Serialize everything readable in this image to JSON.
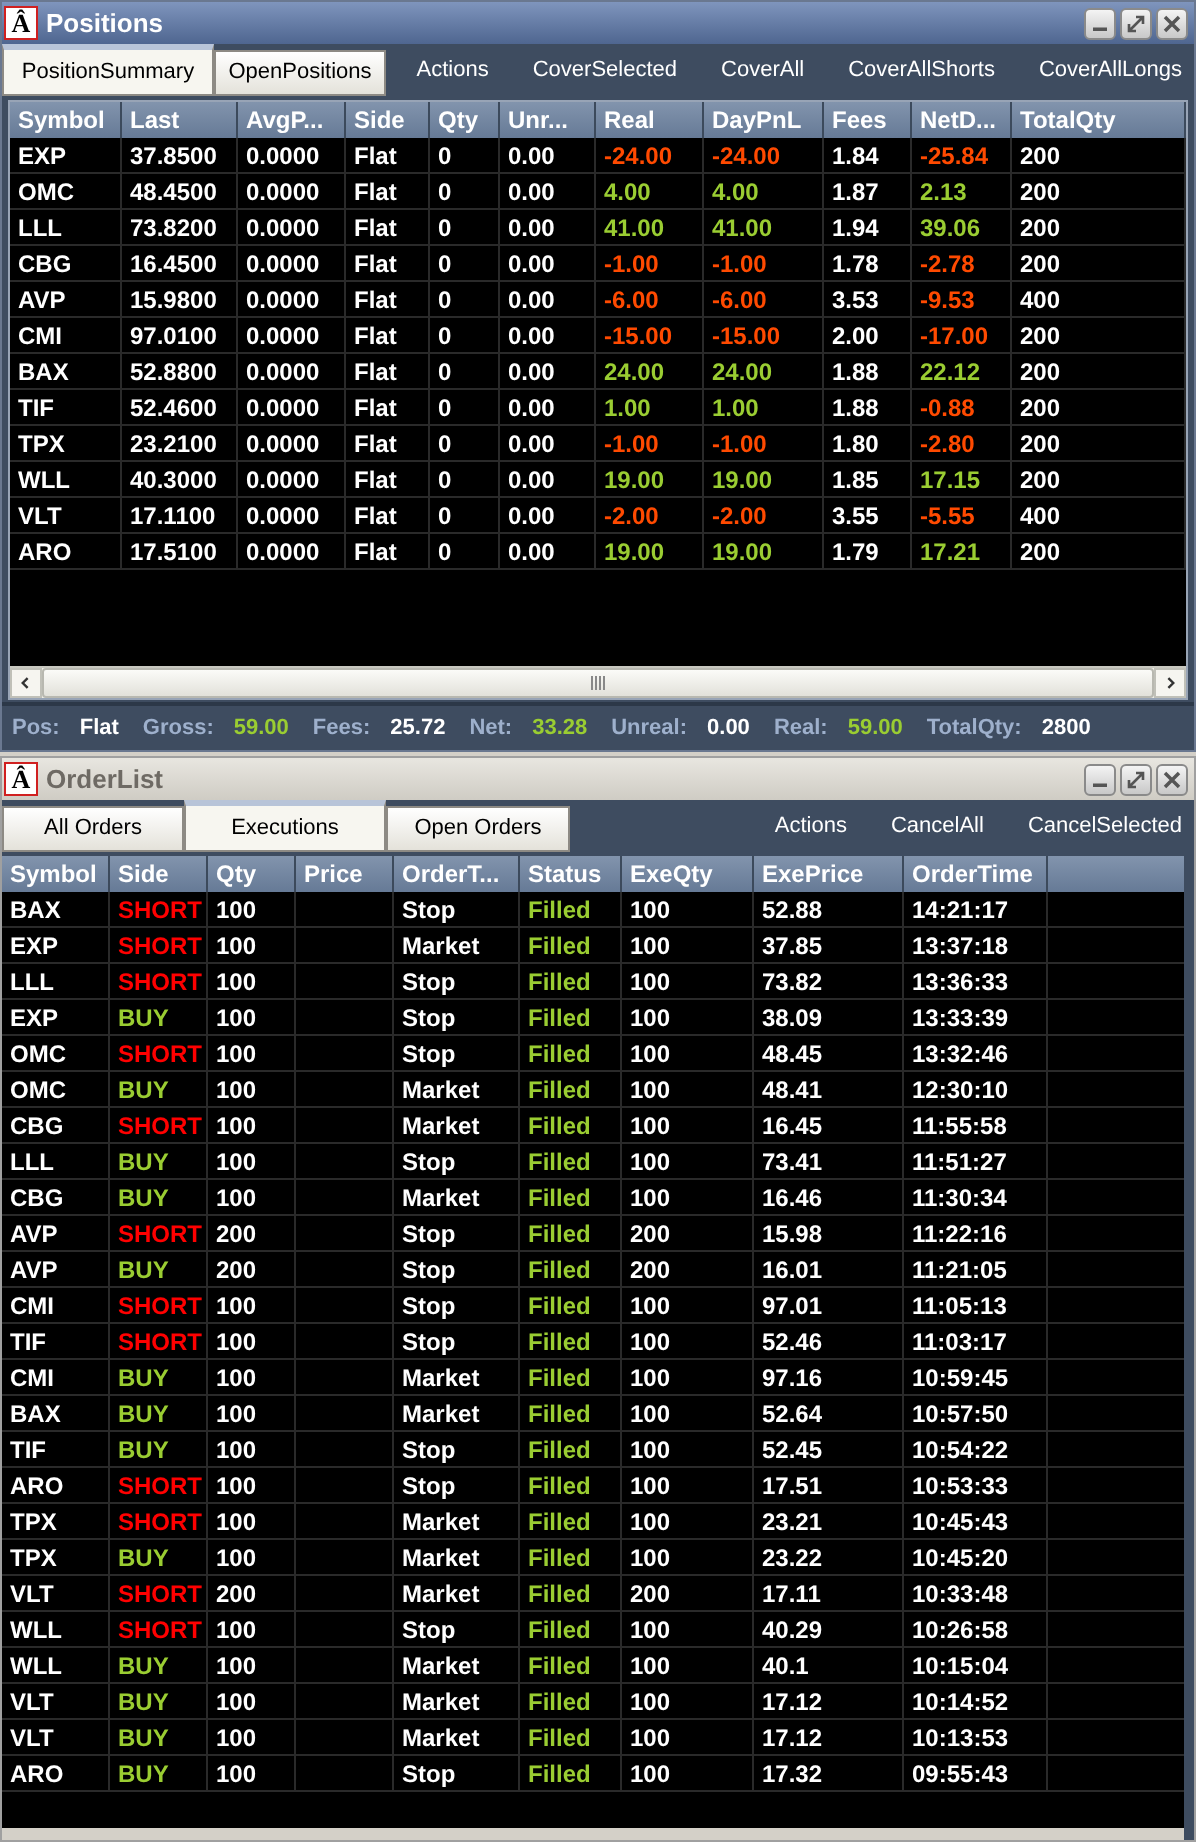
{
  "positions_window": {
    "title": "Positions",
    "icon_glyph": "Â",
    "active": true,
    "tabs": [
      {
        "label": "PositionSummary",
        "selected": true
      },
      {
        "label": "OpenPositions",
        "selected": false
      }
    ],
    "toolbar": [
      "Actions",
      "CoverSelected",
      "CoverAll",
      "CoverAllShorts",
      "CoverAllLongs"
    ],
    "table": {
      "columns": [
        "Symbol",
        "Last",
        "AvgP...",
        "Side",
        "Qty",
        "Unr...",
        "Real",
        "DayPnL",
        "Fees",
        "NetD...",
        "TotalQty"
      ],
      "rows": [
        {
          "symbol": "EXP",
          "last": "37.8500",
          "avg": "0.0000",
          "side": "Flat",
          "qty": "0",
          "unreal": "0.00",
          "real": {
            "text": "-24.00",
            "color": "#ff4a00"
          },
          "daypnl": {
            "text": "-24.00",
            "color": "#ff4a00"
          },
          "fees": "1.84",
          "net": {
            "text": "-25.84",
            "color": "#ff4a00"
          },
          "total_qty": "200"
        },
        {
          "symbol": "OMC",
          "last": "48.4500",
          "avg": "0.0000",
          "side": "Flat",
          "qty": "0",
          "unreal": "0.00",
          "real": {
            "text": "4.00",
            "color": "#9acd32"
          },
          "daypnl": {
            "text": "4.00",
            "color": "#9acd32"
          },
          "fees": "1.87",
          "net": {
            "text": "2.13",
            "color": "#9acd32"
          },
          "total_qty": "200"
        },
        {
          "symbol": "LLL",
          "last": "73.8200",
          "avg": "0.0000",
          "side": "Flat",
          "qty": "0",
          "unreal": "0.00",
          "real": {
            "text": "41.00",
            "color": "#9acd32"
          },
          "daypnl": {
            "text": "41.00",
            "color": "#9acd32"
          },
          "fees": "1.94",
          "net": {
            "text": "39.06",
            "color": "#9acd32"
          },
          "total_qty": "200"
        },
        {
          "symbol": "CBG",
          "last": "16.4500",
          "avg": "0.0000",
          "side": "Flat",
          "qty": "0",
          "unreal": "0.00",
          "real": {
            "text": "-1.00",
            "color": "#ff4a00"
          },
          "daypnl": {
            "text": "-1.00",
            "color": "#ff4a00"
          },
          "fees": "1.78",
          "net": {
            "text": "-2.78",
            "color": "#ff4a00"
          },
          "total_qty": "200"
        },
        {
          "symbol": "AVP",
          "last": "15.9800",
          "avg": "0.0000",
          "side": "Flat",
          "qty": "0",
          "unreal": "0.00",
          "real": {
            "text": "-6.00",
            "color": "#ff4a00"
          },
          "daypnl": {
            "text": "-6.00",
            "color": "#ff4a00"
          },
          "fees": "3.53",
          "net": {
            "text": "-9.53",
            "color": "#ff4a00"
          },
          "total_qty": "400"
        },
        {
          "symbol": "CMI",
          "last": "97.0100",
          "avg": "0.0000",
          "side": "Flat",
          "qty": "0",
          "unreal": "0.00",
          "real": {
            "text": "-15.00",
            "color": "#ff4a00"
          },
          "daypnl": {
            "text": "-15.00",
            "color": "#ff4a00"
          },
          "fees": "2.00",
          "net": {
            "text": "-17.00",
            "color": "#ff4a00"
          },
          "total_qty": "200"
        },
        {
          "symbol": "BAX",
          "last": "52.8800",
          "avg": "0.0000",
          "side": "Flat",
          "qty": "0",
          "unreal": "0.00",
          "real": {
            "text": "24.00",
            "color": "#9acd32"
          },
          "daypnl": {
            "text": "24.00",
            "color": "#9acd32"
          },
          "fees": "1.88",
          "net": {
            "text": "22.12",
            "color": "#9acd32"
          },
          "total_qty": "200"
        },
        {
          "symbol": "TIF",
          "last": "52.4600",
          "avg": "0.0000",
          "side": "Flat",
          "qty": "0",
          "unreal": "0.00",
          "real": {
            "text": "1.00",
            "color": "#9acd32"
          },
          "daypnl": {
            "text": "1.00",
            "color": "#9acd32"
          },
          "fees": "1.88",
          "net": {
            "text": "-0.88",
            "color": "#ff4a00"
          },
          "total_qty": "200"
        },
        {
          "symbol": "TPX",
          "last": "23.2100",
          "avg": "0.0000",
          "side": "Flat",
          "qty": "0",
          "unreal": "0.00",
          "real": {
            "text": "-1.00",
            "color": "#ff4a00"
          },
          "daypnl": {
            "text": "-1.00",
            "color": "#ff4a00"
          },
          "fees": "1.80",
          "net": {
            "text": "-2.80",
            "color": "#ff4a00"
          },
          "total_qty": "200"
        },
        {
          "symbol": "WLL",
          "last": "40.3000",
          "avg": "0.0000",
          "side": "Flat",
          "qty": "0",
          "unreal": "0.00",
          "real": {
            "text": "19.00",
            "color": "#9acd32"
          },
          "daypnl": {
            "text": "19.00",
            "color": "#9acd32"
          },
          "fees": "1.85",
          "net": {
            "text": "17.15",
            "color": "#9acd32"
          },
          "total_qty": "200"
        },
        {
          "symbol": "VLT",
          "last": "17.1100",
          "avg": "0.0000",
          "side": "Flat",
          "qty": "0",
          "unreal": "0.00",
          "real": {
            "text": "-2.00",
            "color": "#ff4a00"
          },
          "daypnl": {
            "text": "-2.00",
            "color": "#ff4a00"
          },
          "fees": "3.55",
          "net": {
            "text": "-5.55",
            "color": "#ff4a00"
          },
          "total_qty": "400"
        },
        {
          "symbol": "ARO",
          "last": "17.5100",
          "avg": "0.0000",
          "side": "Flat",
          "qty": "0",
          "unreal": "0.00",
          "real": {
            "text": "19.00",
            "color": "#9acd32"
          },
          "daypnl": {
            "text": "19.00",
            "color": "#9acd32"
          },
          "fees": "1.79",
          "net": {
            "text": "17.21",
            "color": "#9acd32"
          },
          "total_qty": "200"
        }
      ]
    },
    "status_bar": [
      {
        "label": "Pos:",
        "value": "Flat",
        "color": "#ffffff"
      },
      {
        "label": "Gross:",
        "value": "59.00",
        "color": "#9acd32"
      },
      {
        "label": "Fees:",
        "value": "25.72",
        "color": "#ffffff"
      },
      {
        "label": "Net:",
        "value": "33.28",
        "color": "#9acd32"
      },
      {
        "label": "Unreal:",
        "value": "0.00",
        "color": "#ffffff"
      },
      {
        "label": "Real:",
        "value": "59.00",
        "color": "#9acd32"
      },
      {
        "label": "TotalQty:",
        "value": "2800",
        "color": "#ffffff"
      }
    ]
  },
  "orders_window": {
    "title": "OrderList",
    "icon_glyph": "Â",
    "active": false,
    "tabs": [
      {
        "label": "All Orders",
        "selected": false
      },
      {
        "label": "Executions",
        "selected": true
      },
      {
        "label": "Open Orders",
        "selected": false
      }
    ],
    "toolbar": [
      "Actions",
      "CancelAll",
      "CancelSelected"
    ],
    "table": {
      "columns": [
        "Symbol",
        "Side",
        "Qty",
        "Price",
        "OrderT...",
        "Status",
        "ExeQty",
        "ExePrice",
        "OrderTime"
      ],
      "rows": [
        {
          "symbol": "BAX",
          "side": "SHORT",
          "color": "#ff0000",
          "qty": "100",
          "type": "Stop",
          "status": "Filled",
          "exe_qty": "100",
          "exe_price": "52.88",
          "time": "14:21:17"
        },
        {
          "symbol": "EXP",
          "side": "SHORT",
          "color": "#ff0000",
          "qty": "100",
          "type": "Market",
          "status": "Filled",
          "exe_qty": "100",
          "exe_price": "37.85",
          "time": "13:37:18"
        },
        {
          "symbol": "LLL",
          "side": "SHORT",
          "color": "#ff0000",
          "qty": "100",
          "type": "Stop",
          "status": "Filled",
          "exe_qty": "100",
          "exe_price": "73.82",
          "time": "13:36:33"
        },
        {
          "symbol": "EXP",
          "side": "BUY",
          "color": "#9acd32",
          "qty": "100",
          "type": "Stop",
          "status": "Filled",
          "exe_qty": "100",
          "exe_price": "38.09",
          "time": "13:33:39"
        },
        {
          "symbol": "OMC",
          "side": "SHORT",
          "color": "#ff0000",
          "qty": "100",
          "type": "Stop",
          "status": "Filled",
          "exe_qty": "100",
          "exe_price": "48.45",
          "time": "13:32:46"
        },
        {
          "symbol": "OMC",
          "side": "BUY",
          "color": "#9acd32",
          "qty": "100",
          "type": "Market",
          "status": "Filled",
          "exe_qty": "100",
          "exe_price": "48.41",
          "time": "12:30:10"
        },
        {
          "symbol": "CBG",
          "side": "SHORT",
          "color": "#ff0000",
          "qty": "100",
          "type": "Market",
          "status": "Filled",
          "exe_qty": "100",
          "exe_price": "16.45",
          "time": "11:55:58"
        },
        {
          "symbol": "LLL",
          "side": "BUY",
          "color": "#9acd32",
          "qty": "100",
          "type": "Stop",
          "status": "Filled",
          "exe_qty": "100",
          "exe_price": "73.41",
          "time": "11:51:27"
        },
        {
          "symbol": "CBG",
          "side": "BUY",
          "color": "#9acd32",
          "qty": "100",
          "type": "Market",
          "status": "Filled",
          "exe_qty": "100",
          "exe_price": "16.46",
          "time": "11:30:34"
        },
        {
          "symbol": "AVP",
          "side": "SHORT",
          "color": "#ff0000",
          "qty": "200",
          "type": "Stop",
          "status": "Filled",
          "exe_qty": "200",
          "exe_price": "15.98",
          "time": "11:22:16"
        },
        {
          "symbol": "AVP",
          "side": "BUY",
          "color": "#9acd32",
          "qty": "200",
          "type": "Stop",
          "status": "Filled",
          "exe_qty": "200",
          "exe_price": "16.01",
          "time": "11:21:05"
        },
        {
          "symbol": "CMI",
          "side": "SHORT",
          "color": "#ff0000",
          "qty": "100",
          "type": "Stop",
          "status": "Filled",
          "exe_qty": "100",
          "exe_price": "97.01",
          "time": "11:05:13"
        },
        {
          "symbol": "TIF",
          "side": "SHORT",
          "color": "#ff0000",
          "qty": "100",
          "type": "Stop",
          "status": "Filled",
          "exe_qty": "100",
          "exe_price": "52.46",
          "time": "11:03:17"
        },
        {
          "symbol": "CMI",
          "side": "BUY",
          "color": "#9acd32",
          "qty": "100",
          "type": "Market",
          "status": "Filled",
          "exe_qty": "100",
          "exe_price": "97.16",
          "time": "10:59:45"
        },
        {
          "symbol": "BAX",
          "side": "BUY",
          "color": "#9acd32",
          "qty": "100",
          "type": "Market",
          "status": "Filled",
          "exe_qty": "100",
          "exe_price": "52.64",
          "time": "10:57:50"
        },
        {
          "symbol": "TIF",
          "side": "BUY",
          "color": "#9acd32",
          "qty": "100",
          "type": "Stop",
          "status": "Filled",
          "exe_qty": "100",
          "exe_price": "52.45",
          "time": "10:54:22"
        },
        {
          "symbol": "ARO",
          "side": "SHORT",
          "color": "#ff0000",
          "qty": "100",
          "type": "Stop",
          "status": "Filled",
          "exe_qty": "100",
          "exe_price": "17.51",
          "time": "10:53:33"
        },
        {
          "symbol": "TPX",
          "side": "SHORT",
          "color": "#ff0000",
          "qty": "100",
          "type": "Market",
          "status": "Filled",
          "exe_qty": "100",
          "exe_price": "23.21",
          "time": "10:45:43"
        },
        {
          "symbol": "TPX",
          "side": "BUY",
          "color": "#9acd32",
          "qty": "100",
          "type": "Market",
          "status": "Filled",
          "exe_qty": "100",
          "exe_price": "23.22",
          "time": "10:45:20"
        },
        {
          "symbol": "VLT",
          "side": "SHORT",
          "color": "#ff0000",
          "qty": "200",
          "type": "Market",
          "status": "Filled",
          "exe_qty": "200",
          "exe_price": "17.11",
          "time": "10:33:48"
        },
        {
          "symbol": "WLL",
          "side": "SHORT",
          "color": "#ff0000",
          "qty": "100",
          "type": "Stop",
          "status": "Filled",
          "exe_qty": "100",
          "exe_price": "40.29",
          "time": "10:26:58"
        },
        {
          "symbol": "WLL",
          "side": "BUY",
          "color": "#9acd32",
          "qty": "100",
          "type": "Market",
          "status": "Filled",
          "exe_qty": "100",
          "exe_price": "40.1",
          "time": "10:15:04"
        },
        {
          "symbol": "VLT",
          "side": "BUY",
          "color": "#9acd32",
          "qty": "100",
          "type": "Market",
          "status": "Filled",
          "exe_qty": "100",
          "exe_price": "17.12",
          "time": "10:14:52"
        },
        {
          "symbol": "VLT",
          "side": "BUY",
          "color": "#9acd32",
          "qty": "100",
          "type": "Market",
          "status": "Filled",
          "exe_qty": "100",
          "exe_price": "17.12",
          "time": "10:13:53"
        },
        {
          "symbol": "ARO",
          "side": "BUY",
          "color": "#9acd32",
          "qty": "100",
          "type": "Stop",
          "status": "Filled",
          "exe_qty": "100",
          "exe_price": "17.32",
          "time": "09:55:43"
        }
      ]
    }
  }
}
